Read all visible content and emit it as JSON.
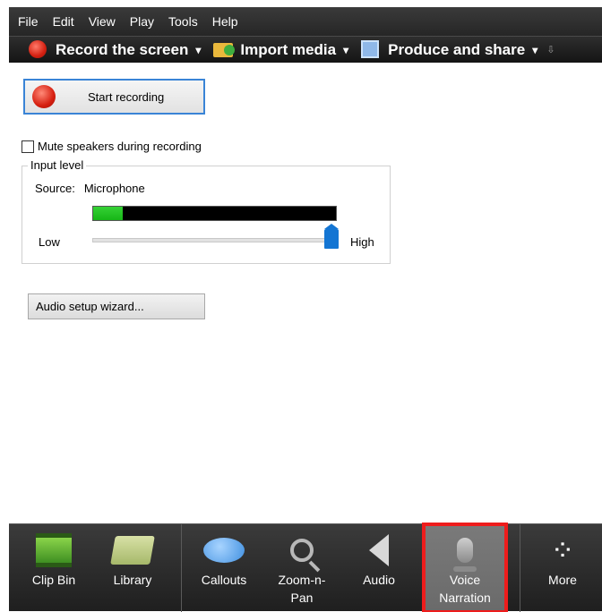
{
  "menu": [
    "File",
    "Edit",
    "View",
    "Play",
    "Tools",
    "Help"
  ],
  "tasks": {
    "record": "Record the screen",
    "import": "Import media",
    "produce": "Produce and share",
    "caret": "▾",
    "overflow": "⇩"
  },
  "recording": {
    "start_label": "Start recording",
    "mute_label": "Mute speakers during recording",
    "mute_checked": false
  },
  "input_level": {
    "title": "Input level",
    "source_label": "Source:",
    "source_value": "Microphone",
    "meter_level": 0.12,
    "slider_low": "Low",
    "slider_high": "High",
    "slider_value": 0.99
  },
  "wizard_label": "Audio setup wizard...",
  "tabs": [
    {
      "label": "Clip Bin",
      "icon": "film-icon"
    },
    {
      "label": "Library",
      "icon": "library-icon"
    },
    {
      "label": "Callouts",
      "icon": "callout-icon"
    },
    {
      "label": "Zoom-n-\nPan",
      "icon": "zoom-icon"
    },
    {
      "label": "Audio",
      "icon": "speaker-icon"
    },
    {
      "label": "Voice\nNarration",
      "icon": "microphone-icon",
      "active": true
    },
    {
      "label": "More",
      "icon": "more-icon"
    }
  ],
  "colors": {
    "accent": "#3a84d6",
    "active_highlight": "#ee1c1c",
    "record_red": "#d42011",
    "meter_green": "#22c322"
  }
}
